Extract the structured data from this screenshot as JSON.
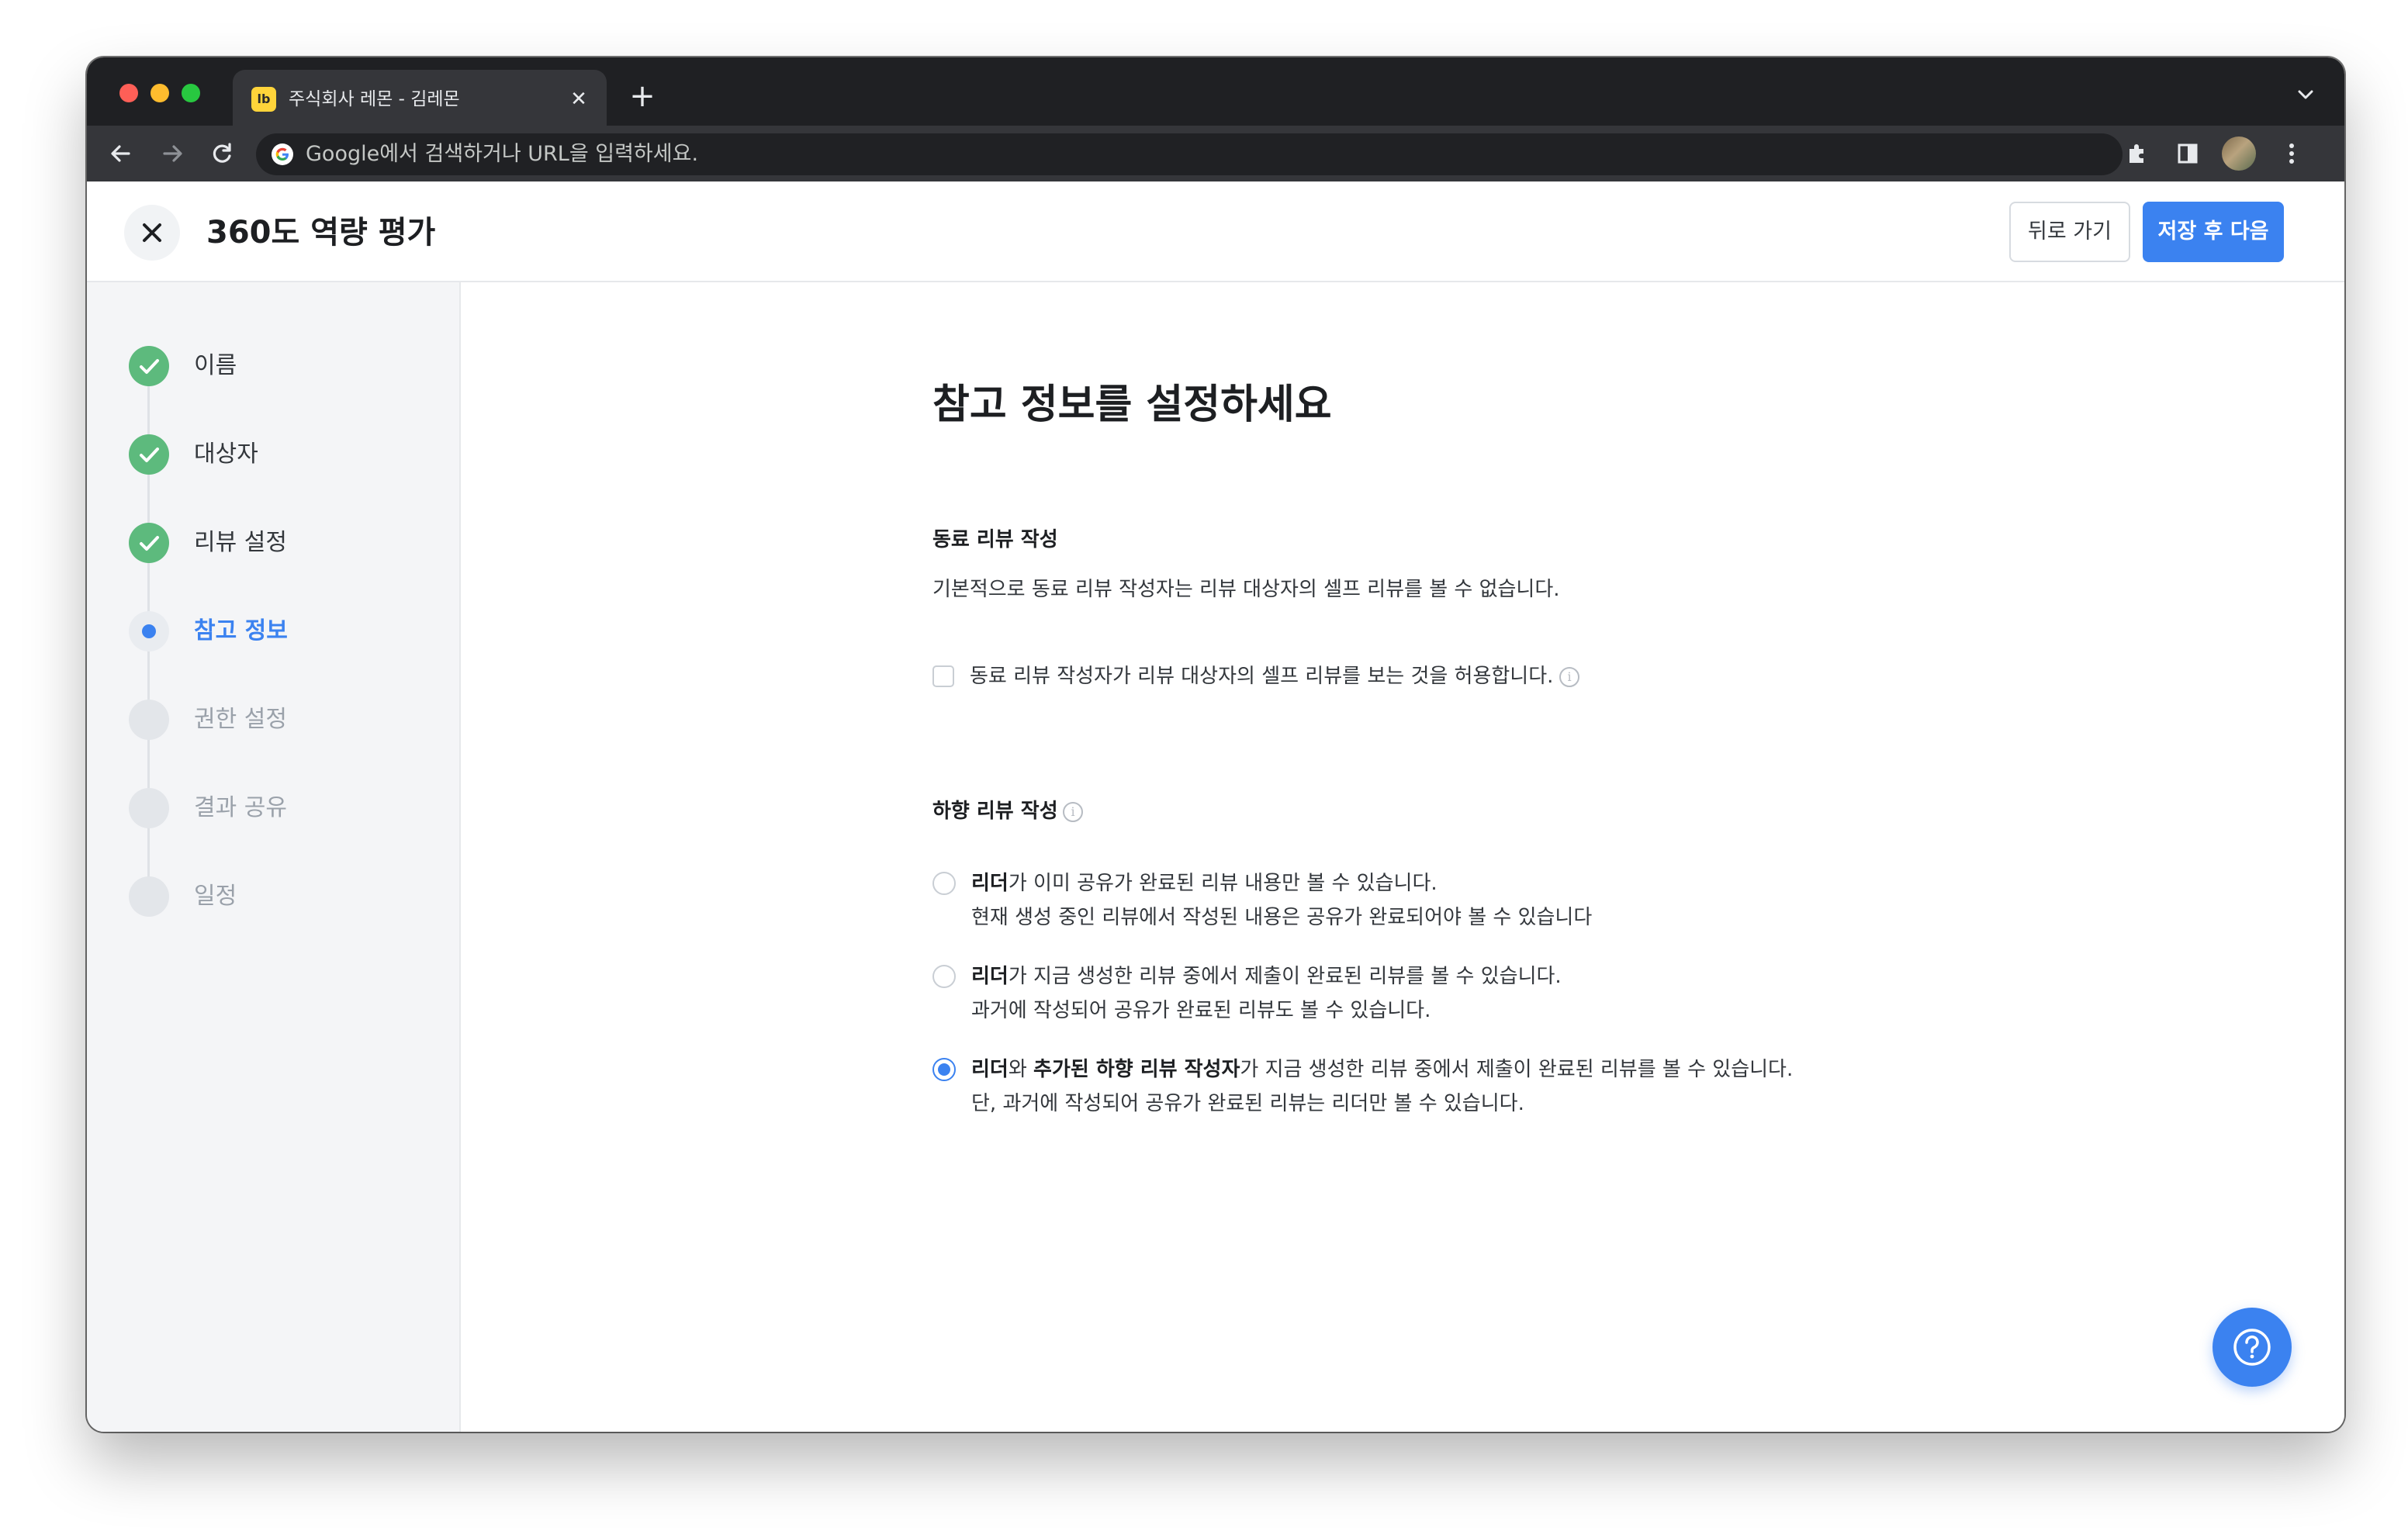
{
  "browser": {
    "tab": {
      "favicon_text": "lb",
      "title": "주식회사 레몬 - 김레몬",
      "close_symbol": "✕"
    },
    "new_tab_symbol": "+",
    "omnibox": {
      "placeholder": "Google에서 검색하거나 URL을 입력하세요."
    }
  },
  "header": {
    "title": "360도 역량 평가",
    "back_button": "뒤로 가기",
    "next_button": "저장 후 다음"
  },
  "sidebar": {
    "steps": [
      {
        "label": "이름",
        "state": "done"
      },
      {
        "label": "대상자",
        "state": "done"
      },
      {
        "label": "리뷰 설정",
        "state": "done"
      },
      {
        "label": "참고 정보",
        "state": "current"
      },
      {
        "label": "권한 설정",
        "state": "todo"
      },
      {
        "label": "결과 공유",
        "state": "todo"
      },
      {
        "label": "일정",
        "state": "todo"
      }
    ]
  },
  "main": {
    "heading": "참고 정보를 설정하세요",
    "peer_section": {
      "title": "동료 리뷰 작성",
      "description": "기본적으로 동료 리뷰 작성자는 리뷰 대상자의 셀프 리뷰를 볼 수 없습니다.",
      "checkbox_label": "동료 리뷰 작성자가 리뷰 대상자의 셀프 리뷰를 보는 것을 허용합니다.",
      "checked": false
    },
    "downward_section": {
      "title": "하향 리뷰 작성",
      "options": [
        {
          "bold1": "리더",
          "text1": "가 이미 공유가 완료된 리뷰 내용만 볼 수 있습니다.",
          "line2": "현재 생성 중인 리뷰에서 작성된 내용은 공유가 완료되어야 볼 수 있습니다",
          "selected": false
        },
        {
          "bold1": "리더",
          "text1": "가 지금 생성한 리뷰 중에서 제출이 완료된 리뷰를 볼 수 있습니다.",
          "line2": "과거에 작성되어 공유가 완료된 리뷰도 볼 수 있습니다.",
          "selected": false
        },
        {
          "bold1": "리더",
          "mid": "와 ",
          "bold2": "추가된 하향 리뷰 작성자",
          "text1": "가 지금 생성한 리뷰 중에서 제출이 완료된 리뷰를 볼 수 있습니다.",
          "line2": "단, 과거에 작성되어 공유가 완료된 리뷰는 리더만 볼 수 있습니다.",
          "selected": true
        }
      ]
    }
  },
  "colors": {
    "accent": "#3b82f0",
    "done": "#5dba7d"
  }
}
